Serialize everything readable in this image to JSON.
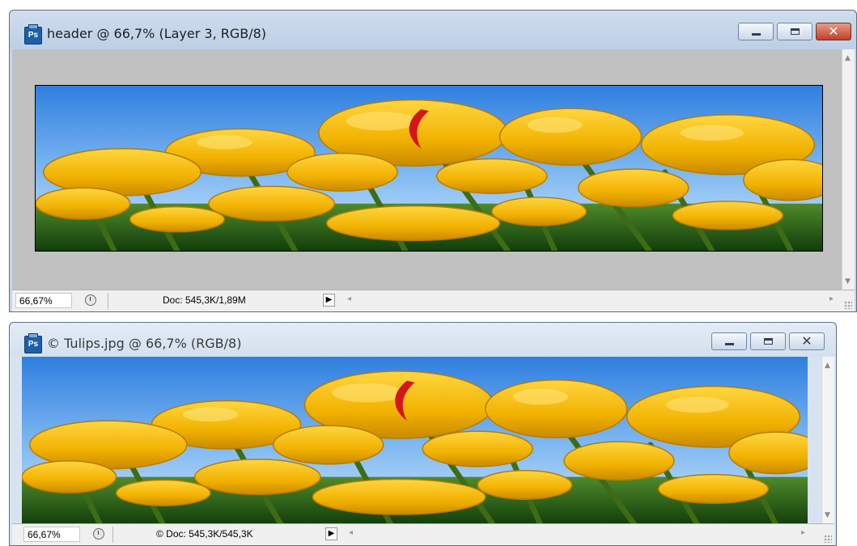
{
  "windows": [
    {
      "title": "header @ 66,7% (Layer 3, RGB/8)",
      "app_icon": "photoshop-document-icon",
      "icon_text": "Ps",
      "status": {
        "zoom": "66,67%",
        "doc_info": "Doc: 545,3K/1,89M"
      }
    },
    {
      "title": "© Tulips.jpg @ 66,7% (RGB/8)",
      "app_icon": "photoshop-document-icon",
      "icon_text": "Ps",
      "status": {
        "zoom": "66,67%",
        "doc_info": "© Doc: 545,3K/545,3K"
      }
    }
  ],
  "glyphs": {
    "play": "▶",
    "left": "◂",
    "right": "▸",
    "up": "▲",
    "down": "▼",
    "close": "✕"
  },
  "colors": {
    "sky": "#5aa0e6",
    "tulip": "#f2b705",
    "stem": "#3f6b16",
    "accent_red": "#d4161b"
  }
}
